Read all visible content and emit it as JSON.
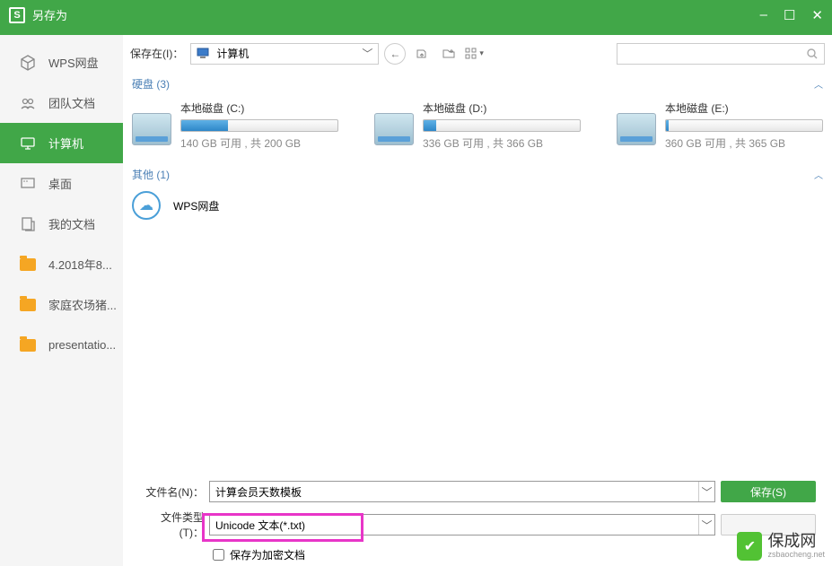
{
  "window": {
    "title": "另存为"
  },
  "sidebar": [
    {
      "label": "WPS网盘",
      "name": "sidebar-wps-cloud"
    },
    {
      "label": "团队文档",
      "name": "sidebar-team-docs"
    },
    {
      "label": "计算机",
      "name": "sidebar-computer",
      "active": true
    },
    {
      "label": "桌面",
      "name": "sidebar-desktop"
    },
    {
      "label": "我的文档",
      "name": "sidebar-my-docs"
    },
    {
      "label": "4.2018年8...",
      "name": "sidebar-folder-1"
    },
    {
      "label": "家庭农场猪...",
      "name": "sidebar-folder-2"
    },
    {
      "label": "presentatio...",
      "name": "sidebar-folder-3"
    }
  ],
  "toolbar": {
    "save_in_label": "保存在(I)：",
    "location": "计算机"
  },
  "sections": {
    "disk_label": "硬盘 (3)",
    "other_label": "其他 (1)"
  },
  "drives": [
    {
      "name": "本地磁盘 (C:)",
      "cap": "140 GB 可用 , 共 200 GB",
      "fill": 30
    },
    {
      "name": "本地磁盘 (D:)",
      "cap": "336 GB 可用 , 共 366 GB",
      "fill": 8
    },
    {
      "name": "本地磁盘 (E:)",
      "cap": "360 GB 可用 , 共 365 GB",
      "fill": 2
    }
  ],
  "other": {
    "wps_label": "WPS网盘"
  },
  "bottom": {
    "filename_label": "文件名(N)：",
    "filename_value": "计算会员天数模板",
    "filetype_label": "文件类型(T)：",
    "filetype_value": "Unicode 文本(*.txt)",
    "save_btn": "保存(S)",
    "encrypt_label": "保存为加密文档"
  },
  "watermark": {
    "main": "保成网",
    "sub": "zsbaocheng.net"
  }
}
